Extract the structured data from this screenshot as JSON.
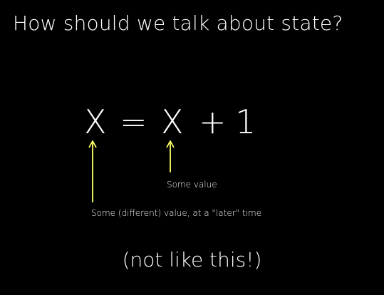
{
  "slide": {
    "title": "How should we talk about state?",
    "equation": {
      "lhs": "X",
      "equals": "=",
      "rhs_var": "X",
      "plus": "+",
      "constant": "1"
    },
    "annotations": {
      "right_label": "Some value",
      "left_label": "Some (different) value, at a \"later\" time"
    },
    "footer": "(not like this!)"
  },
  "colors": {
    "background": "#000000",
    "text": "#ffffff",
    "arrow": "#ffff66"
  }
}
